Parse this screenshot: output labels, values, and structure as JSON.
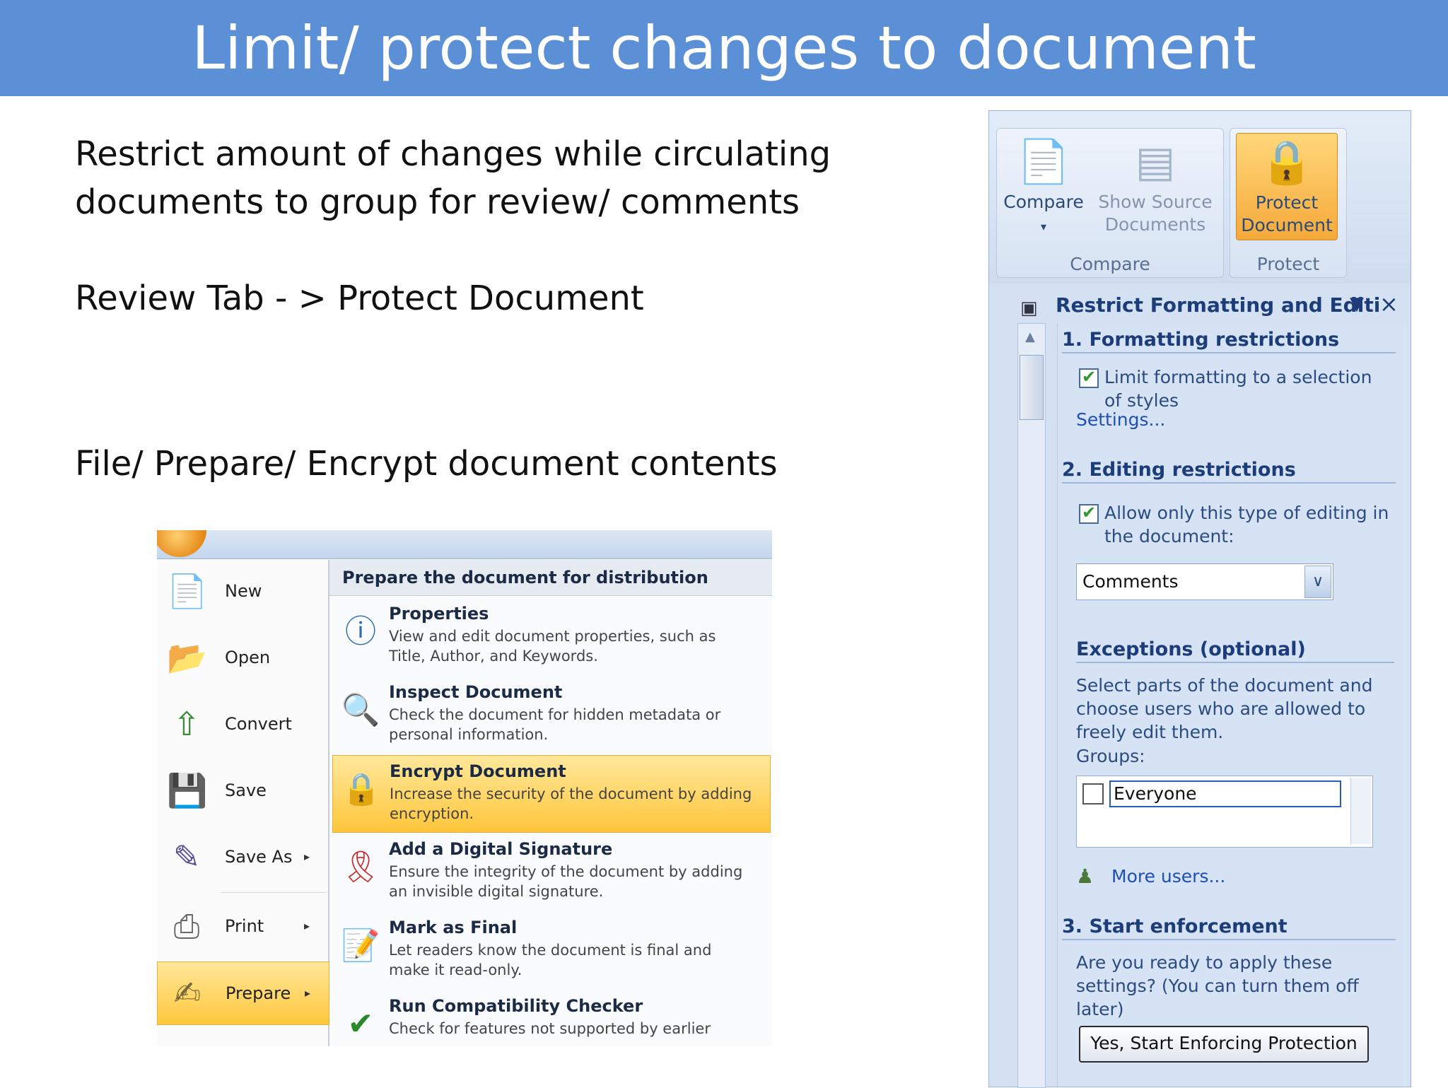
{
  "slide": {
    "title": "Limit/ protect changes to document",
    "bullet1_line1": "Restrict amount of changes while circulating",
    "bullet1_line2": "documents to group for review/ comments",
    "bullet2": "Review Tab - > Protect Document",
    "bullet3": "File/ Prepare/ Encrypt document contents"
  },
  "office_menu": {
    "left_items": [
      {
        "label": "New",
        "icon": "new-document-icon",
        "submenu": false
      },
      {
        "label": "Open",
        "icon": "open-folder-icon",
        "submenu": false
      },
      {
        "label": "Convert",
        "icon": "convert-icon",
        "submenu": false
      },
      {
        "label": "Save",
        "icon": "save-icon",
        "submenu": false
      },
      {
        "label": "Save As",
        "icon": "save-as-icon",
        "submenu": true
      },
      {
        "label": "Print",
        "icon": "print-icon",
        "submenu": true
      },
      {
        "label": "Prepare",
        "icon": "prepare-icon",
        "submenu": true,
        "active": true
      }
    ],
    "right_header": "Prepare the document for distribution",
    "options": [
      {
        "title": "Properties",
        "desc": "View and edit document properties, such as Title, Author, and Keywords.",
        "icon": "properties-icon"
      },
      {
        "title": "Inspect Document",
        "desc": "Check the document for hidden metadata or personal information.",
        "icon": "inspect-document-icon"
      },
      {
        "title": "Encrypt Document",
        "desc": "Increase the security of the document by adding encryption.",
        "icon": "encrypt-lock-icon",
        "highlighted": true
      },
      {
        "title": "Add a Digital Signature",
        "desc": "Ensure the integrity of the document by adding an invisible digital signature.",
        "icon": "digital-signature-icon"
      },
      {
        "title": "Mark as Final",
        "desc": "Let readers know the document is final and make it read-only.",
        "icon": "mark-final-icon"
      },
      {
        "title": "Run Compatibility Checker",
        "desc": "Check for features not supported by earlier",
        "icon": "compatibility-checker-icon"
      }
    ]
  },
  "ribbon": {
    "compare_label": "Compare",
    "show_source_label": "Show Source Documents",
    "protect_label": "Protect Document",
    "group_compare": "Compare",
    "group_protect": "Protect"
  },
  "task_pane": {
    "title": "Restrict Formatting and Editi",
    "section1": "1. Formatting restrictions",
    "limit_formatting": "Limit formatting to a selection of styles",
    "settings_link": "Settings...",
    "section2": "2. Editing restrictions",
    "allow_editing": "Allow only this type of editing in the document:",
    "editing_type": "Comments",
    "exceptions_heading": "Exceptions (optional)",
    "exceptions_text": "Select parts of the document and choose users who are allowed to freely edit them.",
    "groups_label": "Groups:",
    "group_everyone": "Everyone",
    "more_users": "More users...",
    "section3": "3. Start enforcement",
    "enforce_text": "Are you ready to apply these settings? (You can turn them off later)",
    "start_button": "Yes, Start Enforcing Protection"
  },
  "colors": {
    "title_bar": "#5b8fd6",
    "highlight": "#ffc83d",
    "pane_blue": "#d4e1f3"
  }
}
